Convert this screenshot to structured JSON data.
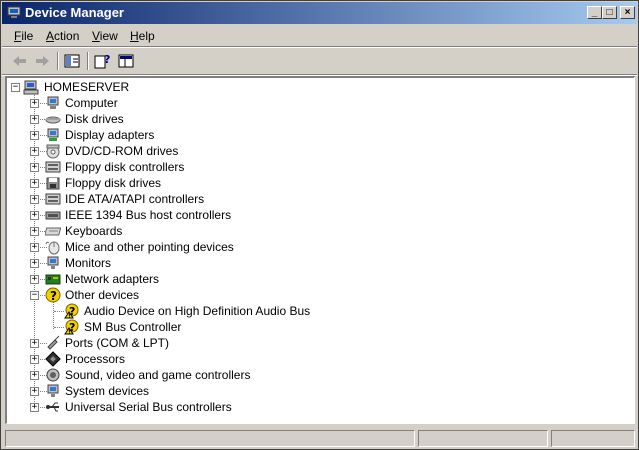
{
  "window": {
    "title": "Device Manager",
    "icon": "device-manager-icon",
    "buttons": {
      "minimize": "_",
      "maximize": "□",
      "close": "×"
    }
  },
  "menu": {
    "file": "File",
    "action": "Action",
    "view": "View",
    "help": "Help"
  },
  "toolbar": {
    "items": [
      "back-arrow-icon",
      "forward-arrow-icon",
      "show-hide-console-tree-icon",
      "properties-help-icon",
      "view-pane-icon"
    ]
  },
  "tree": {
    "root": "HOMESERVER",
    "categories": [
      {
        "label": "Computer",
        "icon": "computer-icon"
      },
      {
        "label": "Disk drives",
        "icon": "disk-drive-icon"
      },
      {
        "label": "Display adapters",
        "icon": "display-adapter-icon"
      },
      {
        "label": "DVD/CD-ROM drives",
        "icon": "cd-rom-icon"
      },
      {
        "label": "Floppy disk controllers",
        "icon": "floppy-controller-icon"
      },
      {
        "label": "Floppy disk drives",
        "icon": "floppy-drive-icon"
      },
      {
        "label": "IDE ATA/ATAPI controllers",
        "icon": "ide-controller-icon"
      },
      {
        "label": "IEEE 1394 Bus host controllers",
        "icon": "ieee1394-icon"
      },
      {
        "label": "Keyboards",
        "icon": "keyboard-icon"
      },
      {
        "label": "Mice and other pointing devices",
        "icon": "mouse-icon"
      },
      {
        "label": "Monitors",
        "icon": "monitor-icon"
      },
      {
        "label": "Network adapters",
        "icon": "network-adapter-icon"
      },
      {
        "label": "Other devices",
        "icon": "unknown-device-icon",
        "expanded": true,
        "children": [
          {
            "label": "Audio Device on High Definition Audio Bus",
            "icon": "warning-device-icon"
          },
          {
            "label": "SM Bus Controller",
            "icon": "warning-device-icon"
          }
        ]
      },
      {
        "label": "Ports (COM & LPT)",
        "icon": "port-icon"
      },
      {
        "label": "Processors",
        "icon": "processor-icon"
      },
      {
        "label": "Sound, video and game controllers",
        "icon": "sound-icon"
      },
      {
        "label": "System devices",
        "icon": "system-device-icon"
      },
      {
        "label": "Universal Serial Bus controllers",
        "icon": "usb-icon"
      }
    ]
  },
  "colors": {
    "titlebar_start": "#0a246a",
    "titlebar_end": "#a6caf0",
    "chrome": "#d4d0c8",
    "warning": "#f0d000"
  }
}
